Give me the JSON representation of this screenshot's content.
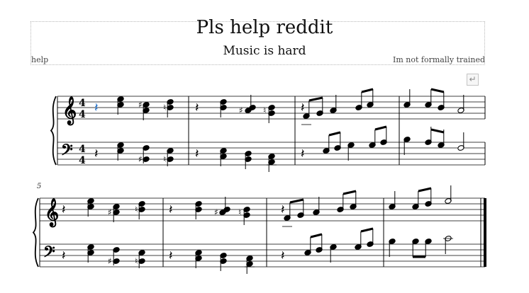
{
  "score": {
    "title": "Pls help reddit",
    "subtitle": "Music is hard",
    "composer": "Im not formally trained",
    "lyricist": "help",
    "layout_break_icon": "return-arrow-icon",
    "measure_number_system2": "5",
    "time_signature": {
      "numerator": "4",
      "denominator": "4"
    },
    "accent_color": "#1e6fc8",
    "clefs": {
      "treble": "𝄞",
      "bass": "𝄢"
    }
  }
}
